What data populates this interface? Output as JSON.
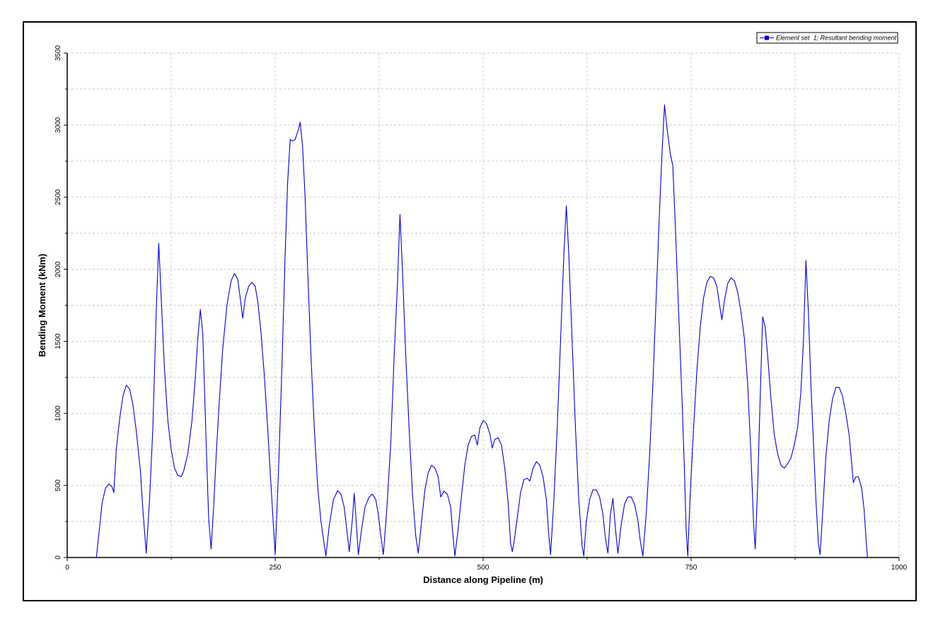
{
  "chart_data": {
    "type": "line",
    "title": "",
    "xlabel": "Distance along Pipeline (m)",
    "ylabel": "Bending Moment (kNm)",
    "xlim": [
      0,
      1000
    ],
    "ylim": [
      0,
      3500
    ],
    "xticks": [
      0,
      250,
      500,
      750,
      1000
    ],
    "yticks": [
      0,
      500,
      1000,
      1500,
      2000,
      2500,
      3000,
      3500
    ],
    "grid": true,
    "legend_position": "top-right",
    "series": [
      {
        "name": "Element set  1; Resultant bending moment",
        "color": "#0000cc",
        "points": [
          [
            35,
            0
          ],
          [
            38,
            160
          ],
          [
            42,
            380
          ],
          [
            46,
            480
          ],
          [
            50,
            510
          ],
          [
            54,
            490
          ],
          [
            56,
            450
          ],
          [
            59,
            750
          ],
          [
            63,
            960
          ],
          [
            67,
            1120
          ],
          [
            71,
            1195
          ],
          [
            75,
            1170
          ],
          [
            79,
            1060
          ],
          [
            83,
            880
          ],
          [
            88,
            600
          ],
          [
            91,
            330
          ],
          [
            95,
            30
          ],
          [
            99,
            400
          ],
          [
            103,
            900
          ],
          [
            107,
            1700
          ],
          [
            110,
            2180
          ],
          [
            113,
            1800
          ],
          [
            117,
            1300
          ],
          [
            121,
            950
          ],
          [
            125,
            750
          ],
          [
            129,
            620
          ],
          [
            133,
            570
          ],
          [
            137,
            560
          ],
          [
            140,
            600
          ],
          [
            145,
            720
          ],
          [
            150,
            950
          ],
          [
            154,
            1250
          ],
          [
            157,
            1520
          ],
          [
            160,
            1720
          ],
          [
            163,
            1550
          ],
          [
            167,
            800
          ],
          [
            170,
            280
          ],
          [
            173,
            60
          ],
          [
            176,
            350
          ],
          [
            179,
            700
          ],
          [
            183,
            1100
          ],
          [
            187,
            1450
          ],
          [
            192,
            1750
          ],
          [
            197,
            1920
          ],
          [
            201,
            1970
          ],
          [
            205,
            1930
          ],
          [
            208,
            1800
          ],
          [
            211,
            1660
          ],
          [
            214,
            1800
          ],
          [
            218,
            1880
          ],
          [
            222,
            1910
          ],
          [
            226,
            1880
          ],
          [
            229,
            1780
          ],
          [
            233,
            1560
          ],
          [
            237,
            1260
          ],
          [
            241,
            900
          ],
          [
            245,
            500
          ],
          [
            250,
            20
          ],
          [
            254,
            600
          ],
          [
            258,
            1300
          ],
          [
            262,
            2100
          ],
          [
            265,
            2600
          ],
          [
            268,
            2900
          ],
          [
            271,
            2890
          ],
          [
            274,
            2900
          ],
          [
            278,
            2970
          ],
          [
            280,
            3020
          ],
          [
            283,
            2850
          ],
          [
            286,
            2500
          ],
          [
            289,
            2000
          ],
          [
            293,
            1400
          ],
          [
            297,
            900
          ],
          [
            301,
            500
          ],
          [
            305,
            250
          ],
          [
            311,
            10
          ],
          [
            315,
            220
          ],
          [
            320,
            400
          ],
          [
            325,
            465
          ],
          [
            329,
            440
          ],
          [
            333,
            350
          ],
          [
            336,
            200
          ],
          [
            339,
            40
          ],
          [
            343,
            280
          ],
          [
            345,
            445
          ],
          [
            347,
            280
          ],
          [
            350,
            20
          ],
          [
            354,
            200
          ],
          [
            358,
            350
          ],
          [
            363,
            420
          ],
          [
            367,
            440
          ],
          [
            371,
            400
          ],
          [
            374,
            300
          ],
          [
            377,
            150
          ],
          [
            380,
            20
          ],
          [
            384,
            320
          ],
          [
            389,
            800
          ],
          [
            393,
            1400
          ],
          [
            397,
            1900
          ],
          [
            400,
            2380
          ],
          [
            403,
            2000
          ],
          [
            407,
            1400
          ],
          [
            411,
            900
          ],
          [
            415,
            450
          ],
          [
            419,
            150
          ],
          [
            422,
            30
          ],
          [
            426,
            250
          ],
          [
            430,
            470
          ],
          [
            434,
            590
          ],
          [
            438,
            640
          ],
          [
            442,
            620
          ],
          [
            446,
            560
          ],
          [
            449,
            420
          ],
          [
            453,
            460
          ],
          [
            457,
            440
          ],
          [
            461,
            350
          ],
          [
            463,
            200
          ],
          [
            466,
            10
          ],
          [
            470,
            200
          ],
          [
            474,
            430
          ],
          [
            478,
            640
          ],
          [
            482,
            780
          ],
          [
            486,
            840
          ],
          [
            490,
            850
          ],
          [
            493,
            780
          ],
          [
            496,
            900
          ],
          [
            500,
            950
          ],
          [
            504,
            930
          ],
          [
            508,
            860
          ],
          [
            511,
            760
          ],
          [
            514,
            820
          ],
          [
            518,
            830
          ],
          [
            522,
            780
          ],
          [
            526,
            620
          ],
          [
            530,
            380
          ],
          [
            533,
            100
          ],
          [
            535,
            40
          ],
          [
            537,
            100
          ],
          [
            540,
            230
          ],
          [
            545,
            450
          ],
          [
            549,
            540
          ],
          [
            553,
            550
          ],
          [
            556,
            530
          ],
          [
            560,
            620
          ],
          [
            564,
            665
          ],
          [
            568,
            640
          ],
          [
            572,
            560
          ],
          [
            576,
            400
          ],
          [
            579,
            150
          ],
          [
            581,
            20
          ],
          [
            585,
            400
          ],
          [
            589,
            900
          ],
          [
            593,
            1500
          ],
          [
            597,
            2100
          ],
          [
            600,
            2440
          ],
          [
            603,
            2100
          ],
          [
            607,
            1500
          ],
          [
            611,
            900
          ],
          [
            615,
            400
          ],
          [
            619,
            80
          ],
          [
            621,
            10
          ],
          [
            624,
            250
          ],
          [
            628,
            400
          ],
          [
            632,
            470
          ],
          [
            636,
            470
          ],
          [
            640,
            420
          ],
          [
            644,
            300
          ],
          [
            647,
            130
          ],
          [
            650,
            30
          ],
          [
            653,
            300
          ],
          [
            656,
            410
          ],
          [
            659,
            200
          ],
          [
            662,
            30
          ],
          [
            666,
            230
          ],
          [
            670,
            370
          ],
          [
            674,
            420
          ],
          [
            678,
            420
          ],
          [
            682,
            370
          ],
          [
            686,
            260
          ],
          [
            689,
            110
          ],
          [
            692,
            10
          ],
          [
            696,
            300
          ],
          [
            700,
            700
          ],
          [
            704,
            1200
          ],
          [
            708,
            1800
          ],
          [
            712,
            2400
          ],
          [
            715,
            2800
          ],
          [
            718,
            3140
          ],
          [
            721,
            2980
          ],
          [
            725,
            2800
          ],
          [
            728,
            2720
          ],
          [
            731,
            2300
          ],
          [
            735,
            1700
          ],
          [
            739,
            1100
          ],
          [
            742,
            600
          ],
          [
            744,
            200
          ],
          [
            746,
            10
          ],
          [
            749,
            450
          ],
          [
            753,
            900
          ],
          [
            757,
            1300
          ],
          [
            761,
            1600
          ],
          [
            765,
            1800
          ],
          [
            769,
            1910
          ],
          [
            773,
            1950
          ],
          [
            777,
            1940
          ],
          [
            781,
            1880
          ],
          [
            784,
            1760
          ],
          [
            787,
            1650
          ],
          [
            790,
            1780
          ],
          [
            794,
            1900
          ],
          [
            798,
            1940
          ],
          [
            802,
            1920
          ],
          [
            806,
            1840
          ],
          [
            810,
            1700
          ],
          [
            814,
            1520
          ],
          [
            818,
            1200
          ],
          [
            822,
            700
          ],
          [
            825,
            250
          ],
          [
            827,
            60
          ],
          [
            830,
            500
          ],
          [
            833,
            1100
          ],
          [
            836,
            1670
          ],
          [
            839,
            1600
          ],
          [
            842,
            1400
          ],
          [
            846,
            1100
          ],
          [
            850,
            850
          ],
          [
            854,
            720
          ],
          [
            858,
            640
          ],
          [
            862,
            620
          ],
          [
            866,
            650
          ],
          [
            870,
            690
          ],
          [
            874,
            780
          ],
          [
            878,
            900
          ],
          [
            882,
            1150
          ],
          [
            885,
            1500
          ],
          [
            888,
            2060
          ],
          [
            891,
            1700
          ],
          [
            894,
            1200
          ],
          [
            897,
            800
          ],
          [
            900,
            400
          ],
          [
            903,
            100
          ],
          [
            905,
            20
          ],
          [
            908,
            300
          ],
          [
            912,
            700
          ],
          [
            916,
            950
          ],
          [
            920,
            1100
          ],
          [
            924,
            1180
          ],
          [
            928,
            1180
          ],
          [
            932,
            1120
          ],
          [
            936,
            1000
          ],
          [
            940,
            850
          ],
          [
            943,
            650
          ],
          [
            945,
            520
          ],
          [
            948,
            560
          ],
          [
            951,
            560
          ],
          [
            955,
            480
          ],
          [
            958,
            330
          ],
          [
            960,
            150
          ],
          [
            962,
            0
          ]
        ]
      }
    ]
  }
}
